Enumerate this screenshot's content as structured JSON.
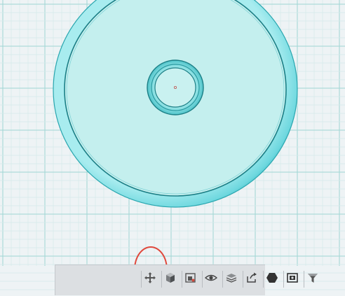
{
  "colors": {
    "background": "#eef3f5",
    "grid_minor": "#d5e9ea",
    "grid_major": "#9fd6d3",
    "disc_fill": "#c7f0ef",
    "disc_rim_light": "#8fe6ec",
    "disc_rim_dark": "#3bbcc4",
    "disc_edge": "#1c7f86",
    "toolbar_bg": "#dcdfe2",
    "annotation": "#e0483c"
  },
  "toolbar": {
    "tools": [
      {
        "name": "move-tool-button",
        "icon": "move-arrows-icon"
      },
      {
        "name": "view-cube-button",
        "icon": "cube-icon"
      },
      {
        "name": "screenshot-button",
        "icon": "camera-frame-icon"
      },
      {
        "name": "visibility-button",
        "icon": "eye-icon"
      },
      {
        "name": "layers-button",
        "icon": "stacked-layers-icon"
      },
      {
        "name": "export-button",
        "icon": "share-arrow-icon"
      },
      {
        "name": "material-button",
        "icon": "solid-hex-icon"
      },
      {
        "name": "render-button",
        "icon": "picture-frame-icon"
      },
      {
        "name": "filter-button",
        "icon": "funnel-icon"
      }
    ]
  }
}
